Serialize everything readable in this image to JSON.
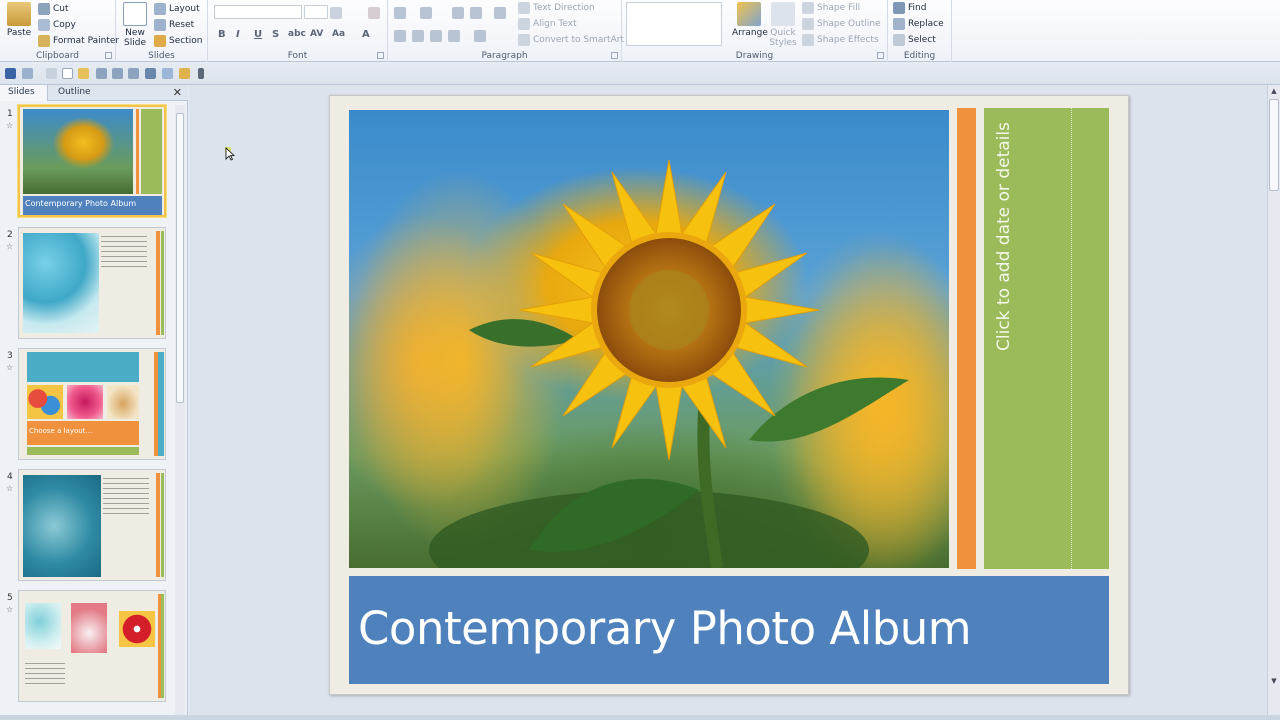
{
  "ribbon": {
    "clipboard": {
      "paste": "Paste",
      "cut": "Cut",
      "copy": "Copy",
      "format_painter": "Format Painter",
      "label": "Clipboard"
    },
    "slides": {
      "new_slide": "New Slide",
      "layout": "Layout",
      "reset": "Reset",
      "section": "Section",
      "label": "Slides"
    },
    "font": {
      "label": "Font",
      "bold": "B",
      "italic": "I",
      "underline": "U",
      "strike": "S",
      "shadow": "abc",
      "spacing": "AV",
      "case": "Aa",
      "color": "A"
    },
    "paragraph": {
      "label": "Paragraph",
      "text_direction": "Text Direction",
      "align_text": "Align Text",
      "convert_smartart": "Convert to SmartArt"
    },
    "drawing": {
      "label": "Drawing",
      "arrange": "Arrange",
      "quick_styles": "Quick Styles",
      "shape_fill": "Shape Fill",
      "shape_outline": "Shape Outline",
      "shape_effects": "Shape Effects"
    },
    "editing": {
      "label": "Editing",
      "find": "Find",
      "replace": "Replace",
      "select": "Select"
    }
  },
  "pane": {
    "tabs": [
      "Slides",
      "Outline"
    ],
    "thumbnails": [
      {
        "num": "1",
        "title": "Contemporary Photo Album"
      },
      {
        "num": "2"
      },
      {
        "num": "3",
        "title": "Choose a layout..."
      },
      {
        "num": "4"
      },
      {
        "num": "5"
      }
    ]
  },
  "slide": {
    "title": "Contemporary Photo Album",
    "date_placeholder": "Click to add date or details"
  },
  "colors": {
    "title_blue": "#4f81bd",
    "accent_orange": "#f0913e",
    "accent_green": "#9bba59",
    "slide_bg": "#efece3"
  }
}
